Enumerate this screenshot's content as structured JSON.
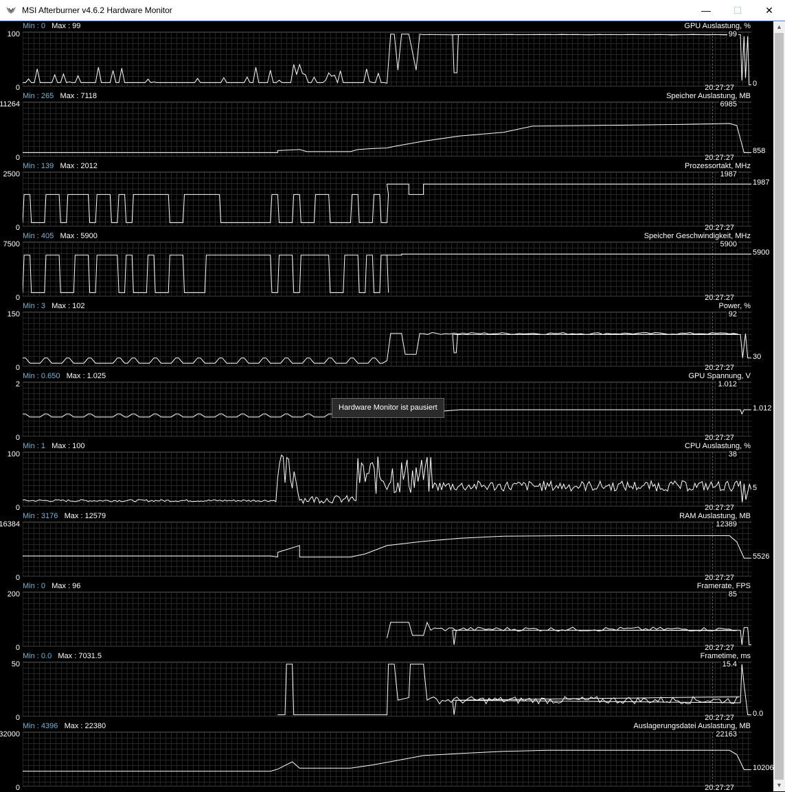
{
  "window": {
    "title": "MSI Afterburner v4.6.2 Hardware Monitor",
    "controls": {
      "minimize": "—",
      "maximize": "☐",
      "close": "✕"
    }
  },
  "tooltip": "Hardware Monitor ist pausiert",
  "min_key": "Min : ",
  "max_key": "Max : ",
  "time": "20:27:27",
  "colors": {
    "trace": "#ffffff",
    "grid": "#262626",
    "background": "#000000",
    "min_label": "#7db3d4"
  },
  "panels": [
    {
      "name": "GPU Auslastung, %",
      "min": "0",
      "max": "99",
      "ymax": "100",
      "ymin": "0",
      "cursor_value": "99",
      "current_value": "0",
      "shape": {
        "type": "pulse",
        "base": 0.06,
        "spikes": [
          [
            0,
            0.05,
            0.2
          ],
          [
            0.06,
            0.09,
            0.35
          ],
          [
            0.1,
            0.13,
            0.25
          ],
          [
            0.22,
            0.24,
            0.3
          ],
          [
            0.28,
            0.32,
            0.25
          ],
          [
            0.34,
            0.36,
            0.2
          ],
          [
            0.37,
            0.38,
            0.45
          ]
        ],
        "segs": [
          [
            0,
            0.37,
            "low"
          ],
          [
            0.38,
            0.42,
            "mixed"
          ],
          [
            0.43,
            0.45,
            "high"
          ],
          [
            0.45,
            0.52,
            "toggle"
          ],
          [
            0.52,
            0.97,
            0.99
          ],
          [
            0.97,
            1,
            "drop"
          ]
        ]
      }
    },
    {
      "name": "Speicher Auslastung, MB",
      "min": "265",
      "max": "7118",
      "ymax": "11264",
      "ymin": "0",
      "cursor_value": "6985",
      "current_value": "858",
      "shape": {
        "type": "curve",
        "pts": [
          [
            0,
            0.06
          ],
          [
            0.35,
            0.06
          ],
          [
            0.35,
            0.1
          ],
          [
            0.38,
            0.12
          ],
          [
            0.39,
            0.08
          ],
          [
            0.45,
            0.08
          ],
          [
            0.46,
            0.12
          ],
          [
            0.48,
            0.14
          ],
          [
            0.5,
            0.15
          ],
          [
            0.51,
            0.18
          ],
          [
            0.55,
            0.28
          ],
          [
            0.6,
            0.38
          ],
          [
            0.66,
            0.45
          ],
          [
            0.7,
            0.57
          ],
          [
            0.78,
            0.58
          ],
          [
            0.9,
            0.6
          ],
          [
            0.97,
            0.62
          ],
          [
            0.98,
            0.58
          ],
          [
            0.99,
            0.06
          ],
          [
            1,
            0.06
          ]
        ]
      }
    },
    {
      "name": "Prozessortakt, MHz",
      "min": "139",
      "max": "2012",
      "ymax": "2500",
      "ymin": "0",
      "cursor_value": "1987",
      "current_value": "1987",
      "shape": {
        "type": "square",
        "low": 0.06,
        "high": 0.6,
        "toggles": [
          0,
          0.01,
          0.03,
          0.05,
          0.06,
          0.09,
          0.1,
          0.12,
          0.13,
          0.14,
          0.15,
          0.2,
          0.22,
          0.27,
          0.34,
          0.35,
          0.37,
          0.38,
          0.4,
          0.42,
          0.45,
          0.46,
          0.48,
          0.49,
          0.5
        ],
        "after": [
          [
            0.5,
            0.53,
            0.8
          ],
          [
            0.53,
            0.55,
            0.6
          ],
          [
            0.55,
            1,
            0.8
          ]
        ]
      }
    },
    {
      "name": "Speicher Geschwindigkeit, MHz",
      "min": "405",
      "max": "5900",
      "ymax": "7500",
      "ymin": "0",
      "cursor_value": "5900",
      "current_value": "5900",
      "shape": {
        "type": "square",
        "low": 0.06,
        "high": 0.78,
        "toggles": [
          0,
          0.01,
          0.03,
          0.05,
          0.07,
          0.09,
          0.1,
          0.13,
          0.14,
          0.15,
          0.17,
          0.18,
          0.2,
          0.22,
          0.25,
          0.34,
          0.35,
          0.37,
          0.38,
          0.42,
          0.44,
          0.46,
          0.47,
          0.48,
          0.49,
          0.5
        ],
        "after": [
          [
            0.5,
            0.52,
            0.78
          ],
          [
            0.52,
            1,
            0.8
          ]
        ]
      }
    },
    {
      "name": "Power, %",
      "min": "3",
      "max": "102",
      "ymax": "150",
      "ymin": "0",
      "cursor_value": "92",
      "current_value": "30",
      "shape": {
        "type": "pulse2",
        "base": 0.05,
        "bumps": 0.15,
        "high": 0.62,
        "start": 0.5
      }
    },
    {
      "name": "GPU Spannung, V",
      "min": "0.650",
      "max": "1.025",
      "ymax": "2",
      "ymin": "0",
      "cursor_value": "1.012",
      "current_value": "1.012",
      "shape": {
        "type": "volt",
        "low": 0.36,
        "high": 0.5
      }
    },
    {
      "name": "CPU Auslastung, %",
      "min": "1",
      "max": "100",
      "ymax": "100",
      "ymin": "0",
      "cursor_value": "38",
      "current_value": "5",
      "shape": {
        "type": "noise",
        "base": 0.1,
        "amp": 0.04,
        "later": 0.38,
        "lateramp": 0.1
      }
    },
    {
      "name": "RAM Auslastung, MB",
      "min": "3176",
      "max": "12579",
      "ymax": "16384",
      "ymin": "0",
      "cursor_value": "12389",
      "current_value": "5526",
      "shape": {
        "type": "curve",
        "pts": [
          [
            0,
            0.38
          ],
          [
            0.34,
            0.38
          ],
          [
            0.35,
            0.36
          ],
          [
            0.35,
            0.45
          ],
          [
            0.38,
            0.58
          ],
          [
            0.38,
            0.36
          ],
          [
            0.45,
            0.36
          ],
          [
            0.47,
            0.42
          ],
          [
            0.5,
            0.58
          ],
          [
            0.55,
            0.66
          ],
          [
            0.6,
            0.72
          ],
          [
            0.66,
            0.76
          ],
          [
            0.75,
            0.77
          ],
          [
            0.97,
            0.77
          ],
          [
            0.98,
            0.65
          ],
          [
            0.99,
            0.34
          ],
          [
            1,
            0.34
          ]
        ]
      }
    },
    {
      "name": "Framerate, FPS",
      "min": "0",
      "max": "96",
      "ymax": "200",
      "ymin": "0",
      "cursor_value": "85",
      "current_value": "",
      "shape": {
        "type": "fps"
      }
    },
    {
      "name": "Frametime, ms",
      "min": "0.0",
      "max": "7031.5",
      "ymax": "50",
      "ymin": "0",
      "cursor_value": "15.4",
      "current_value": "0.0",
      "shape": {
        "type": "frametime"
      }
    },
    {
      "name": "Auslagerungsdatei Auslastung, MB",
      "min": "4396",
      "max": "22380",
      "ymax": "32000",
      "ymin": "0",
      "cursor_value": "22163",
      "current_value": "10206",
      "shape": {
        "type": "curve",
        "pts": [
          [
            0,
            0.28
          ],
          [
            0.34,
            0.28
          ],
          [
            0.35,
            0.32
          ],
          [
            0.37,
            0.46
          ],
          [
            0.38,
            0.34
          ],
          [
            0.45,
            0.34
          ],
          [
            0.48,
            0.4
          ],
          [
            0.5,
            0.45
          ],
          [
            0.55,
            0.58
          ],
          [
            0.6,
            0.62
          ],
          [
            0.66,
            0.66
          ],
          [
            0.72,
            0.68
          ],
          [
            0.97,
            0.68
          ],
          [
            0.98,
            0.6
          ],
          [
            0.99,
            0.31
          ],
          [
            1,
            0.31
          ]
        ]
      }
    }
  ]
}
